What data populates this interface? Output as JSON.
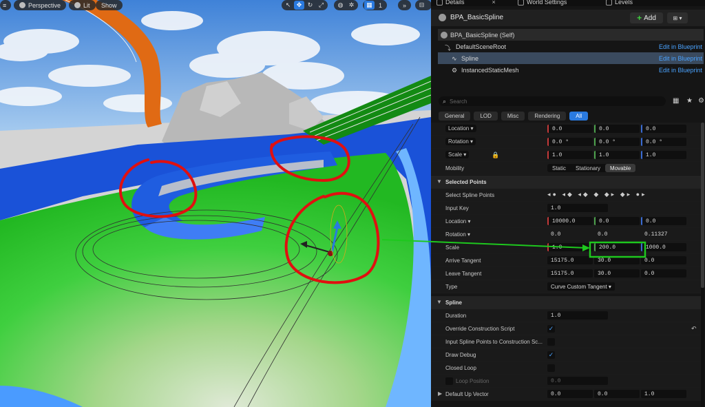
{
  "viewport": {
    "perspective_label": "Perspective",
    "lit_label": "Lit",
    "show_label": "Show",
    "camera_speed": "1"
  },
  "tabs": [
    {
      "label": "Details"
    },
    {
      "label": "World Settings"
    },
    {
      "label": "Levels"
    }
  ],
  "details": {
    "actor_name": "BPA_BasicSpline",
    "add_label": "Add",
    "search_placeholder": "Search",
    "components": [
      {
        "label": "BPA_BasicSpline (Self)",
        "edit": ""
      },
      {
        "label": "DefaultSceneRoot",
        "edit": "Edit in Blueprint"
      },
      {
        "label": "Spline",
        "edit": "Edit in Blueprint"
      },
      {
        "label": "InstancedStaticMesh",
        "edit": "Edit in Blueprint"
      }
    ],
    "filters": [
      "General",
      "LOD",
      "Misc",
      "Rendering",
      "All"
    ],
    "transform": {
      "location": {
        "label": "Location",
        "x": "0.0",
        "y": "0.0",
        "z": "0.0"
      },
      "rotation": {
        "label": "Rotation",
        "x": "0.0 °",
        "y": "0.0 °",
        "z": "0.0 °"
      },
      "scale": {
        "label": "Scale",
        "x": "1.0",
        "y": "1.0",
        "z": "1.0"
      },
      "mobility_label": "Mobility",
      "mobility_options": [
        "Static",
        "Stationary",
        "Movable"
      ]
    },
    "selected_points": {
      "header": "Selected Points",
      "select_label": "Select Spline Points",
      "input_key_label": "Input Key",
      "input_key": "1.0",
      "location": {
        "label": "Location",
        "x": "10000.0",
        "y": "0.0",
        "z": "0.0"
      },
      "rotation": {
        "label": "Rotation",
        "x": "0.0",
        "y": "0.0",
        "z": "0.11327"
      },
      "scale": {
        "label": "Scale",
        "x": "1.0",
        "y": "200.0",
        "z": "1000.0"
      },
      "arrive": {
        "label": "Arrive Tangent",
        "x": "15175.0",
        "y": "30.0",
        "z": "0.0"
      },
      "leave": {
        "label": "Leave Tangent",
        "x": "15175.0",
        "y": "30.0",
        "z": "0.0"
      },
      "type_label": "Type",
      "type_value": "Curve Custom Tangent"
    },
    "spline": {
      "header": "Spline",
      "duration_label": "Duration",
      "duration": "1.0",
      "override_label": "Override Construction Script",
      "input_points_label": "Input Spline Points to Construction Sc...",
      "draw_debug_label": "Draw Debug",
      "closed_loop_label": "Closed Loop",
      "loop_position_label": "Loop Position",
      "loop_position": "0.0",
      "up_vector_label": "Default Up Vector",
      "up_vector": {
        "x": "0.0",
        "y": "0.0",
        "z": "1.0"
      }
    }
  },
  "colors": {
    "accent": "#2a7adf",
    "annotation_red": "#e01010",
    "annotation_green": "#1ec81e"
  }
}
